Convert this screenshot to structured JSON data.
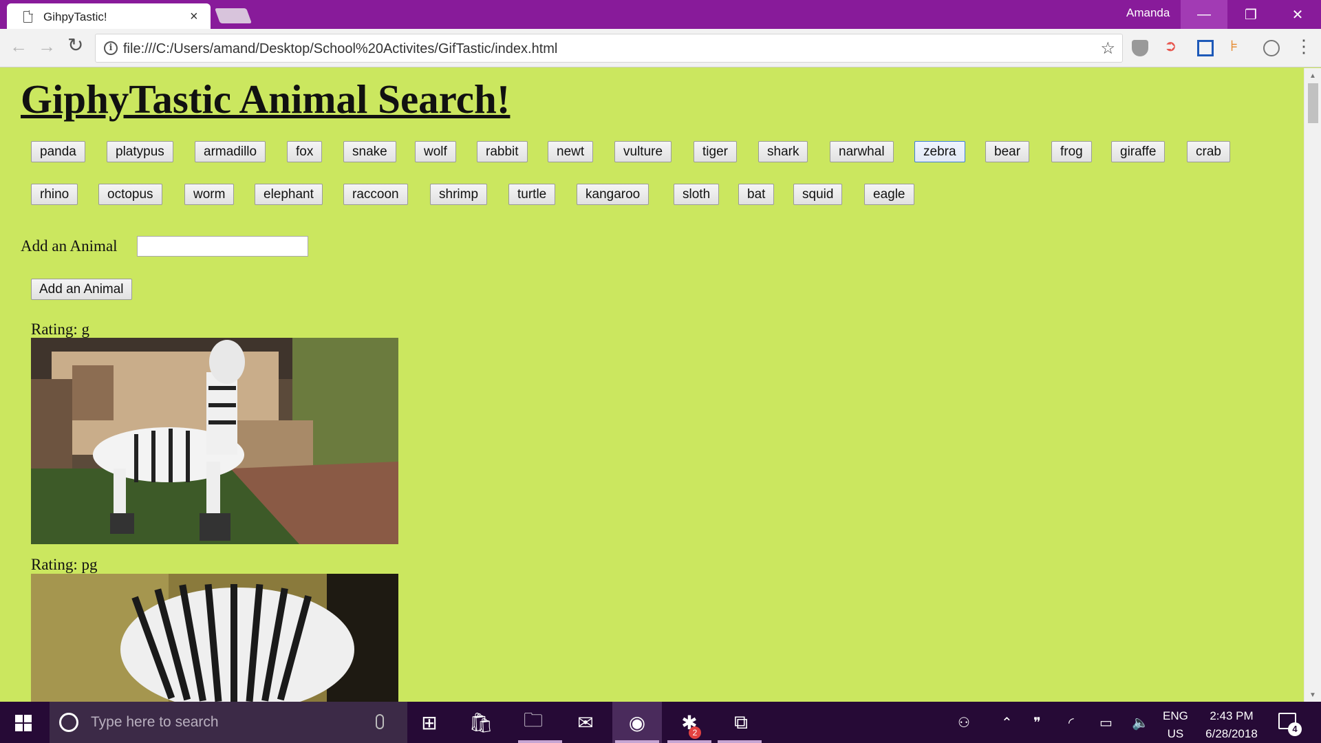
{
  "browser": {
    "tab_title": "GihpyTastic!",
    "tab_close": "×",
    "profile_name": "Amanda",
    "url": "file:///C:/Users/amand/Desktop/School%20Activites/GifTastic/index.html",
    "window_controls": {
      "minimize": "—",
      "maximize": "❐",
      "close": "✕"
    }
  },
  "page": {
    "title": "GiphyTastic Animal Search!",
    "animals": [
      "panda",
      "platypus",
      "armadillo",
      "fox",
      "snake",
      "wolf",
      "rabbit",
      "newt",
      "vulture",
      "tiger",
      "shark",
      "narwhal",
      "zebra",
      "bear",
      "frog",
      "giraffe",
      "crab",
      "rhino",
      "octopus",
      "worm",
      "elephant",
      "raccoon",
      "shrimp",
      "turtle",
      "kangaroo",
      "sloth",
      "bat",
      "squid",
      "eagle"
    ],
    "active_animal": "zebra",
    "add_label": "Add an Animal",
    "add_input_value": "",
    "add_button": "Add an Animal",
    "results": [
      {
        "rating": "Rating: g"
      },
      {
        "rating": "Rating: pg"
      }
    ]
  },
  "taskbar": {
    "search_placeholder": "Type here to search",
    "slack_badge": "2",
    "lang_top": "ENG",
    "lang_bottom": "US",
    "time": "2:43 PM",
    "date": "6/28/2018",
    "notification_count": "4"
  },
  "colors": {
    "page_bg": "#cbe75f",
    "titlebar": "#881b9a",
    "taskbar": "#260a36"
  }
}
